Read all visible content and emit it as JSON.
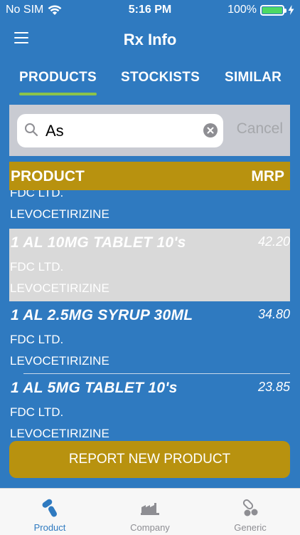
{
  "status_bar": {
    "carrier": "No SIM",
    "time": "5:16 PM",
    "battery": "100%",
    "battery_level": 1.0
  },
  "navbar": {
    "title": "Rx Info",
    "menu_icon": "hamburger-menu-icon"
  },
  "tabs": [
    {
      "label": "PRODUCTS",
      "active": true
    },
    {
      "label": "STOCKISTS",
      "active": false
    },
    {
      "label": "SIMILAR",
      "active": false
    }
  ],
  "search": {
    "value": "As",
    "cancel_label": "Cancel"
  },
  "table": {
    "col_product": "PRODUCT",
    "col_mrp": "MRP"
  },
  "rows": [
    {
      "name": "",
      "mrp": "",
      "company": "FDC LTD.",
      "generic": "LEVOCETIRIZINE"
    },
    {
      "name": "1 AL 10MG TABLET 10's",
      "mrp": "42.20",
      "company": "FDC LTD.",
      "generic": "LEVOCETIRIZINE",
      "selected": true
    },
    {
      "name": "1 AL 2.5MG SYRUP 30ML",
      "mrp": "34.80",
      "company": "FDC LTD.",
      "generic": "LEVOCETIRIZINE"
    },
    {
      "name": "1 AL 5MG TABLET 10's",
      "mrp": "23.85",
      "company": "FDC LTD.",
      "generic": "LEVOCETIRIZINE"
    }
  ],
  "report_button": "REPORT NEW PRODUCT",
  "tabbar": [
    {
      "label": "Product",
      "icon": "pills-icon",
      "active": true
    },
    {
      "label": "Company",
      "icon": "factory-icon",
      "active": false
    },
    {
      "label": "Generic",
      "icon": "tablets-icon",
      "active": false
    }
  ],
  "colors": {
    "primary": "#2f7ac0",
    "accent": "#b8920f",
    "tab_indicator": "#8bc34a",
    "tabbar_active": "#2f7ac0",
    "tabbar_inactive": "#8e8e93"
  }
}
